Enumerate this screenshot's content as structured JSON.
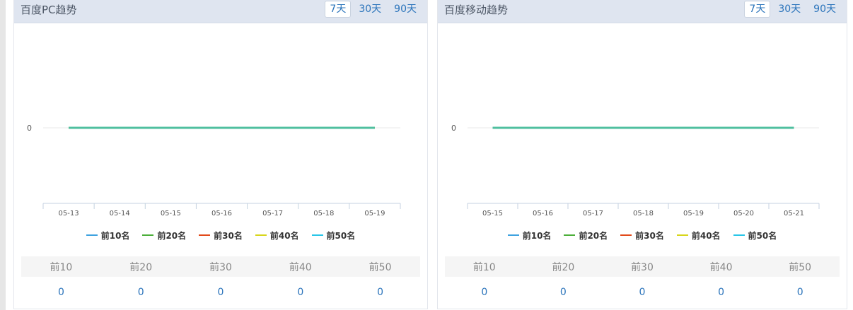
{
  "pc": {
    "title": "百度PC趋势",
    "ranges": [
      "7天",
      "30天",
      "90天"
    ],
    "active_range": "7天",
    "stats_headers": [
      "前10",
      "前20",
      "前30",
      "前40",
      "前50"
    ],
    "stats_values": [
      "0",
      "0",
      "0",
      "0",
      "0"
    ]
  },
  "mobile": {
    "title": "百度移动趋势",
    "ranges": [
      "7天",
      "30天",
      "90天"
    ],
    "active_range": "7天",
    "stats_headers": [
      "前10",
      "前20",
      "前30",
      "前40",
      "前50"
    ],
    "stats_values": [
      "0",
      "0",
      "0",
      "0",
      "0"
    ]
  },
  "colors": {
    "series": [
      "#3fa3e0",
      "#4caf3a",
      "#e24a1b",
      "#d8d61c",
      "#29c6e8"
    ],
    "plot_line": "#4fbf9f"
  },
  "chart_data": [
    {
      "type": "line",
      "categories": [
        "05-13",
        "05-14",
        "05-15",
        "05-16",
        "05-17",
        "05-18",
        "05-19"
      ],
      "yticks": [
        "0"
      ],
      "series": [
        {
          "name": "前10名",
          "values": [
            0,
            0,
            0,
            0,
            0,
            0,
            0
          ]
        },
        {
          "name": "前20名",
          "values": [
            0,
            0,
            0,
            0,
            0,
            0,
            0
          ]
        },
        {
          "name": "前30名",
          "values": [
            0,
            0,
            0,
            0,
            0,
            0,
            0
          ]
        },
        {
          "name": "前40名",
          "values": [
            0,
            0,
            0,
            0,
            0,
            0,
            0
          ]
        },
        {
          "name": "前50名",
          "values": [
            0,
            0,
            0,
            0,
            0,
            0,
            0
          ]
        }
      ],
      "legend": "bottom"
    },
    {
      "type": "line",
      "categories": [
        "05-15",
        "05-16",
        "05-17",
        "05-18",
        "05-19",
        "05-20",
        "05-21"
      ],
      "yticks": [
        "0"
      ],
      "series": [
        {
          "name": "前10名",
          "values": [
            0,
            0,
            0,
            0,
            0,
            0,
            0
          ]
        },
        {
          "name": "前20名",
          "values": [
            0,
            0,
            0,
            0,
            0,
            0,
            0
          ]
        },
        {
          "name": "前30名",
          "values": [
            0,
            0,
            0,
            0,
            0,
            0,
            0
          ]
        },
        {
          "name": "前40名",
          "values": [
            0,
            0,
            0,
            0,
            0,
            0,
            0
          ]
        },
        {
          "name": "前50名",
          "values": [
            0,
            0,
            0,
            0,
            0,
            0,
            0
          ]
        }
      ],
      "legend": "bottom"
    }
  ]
}
